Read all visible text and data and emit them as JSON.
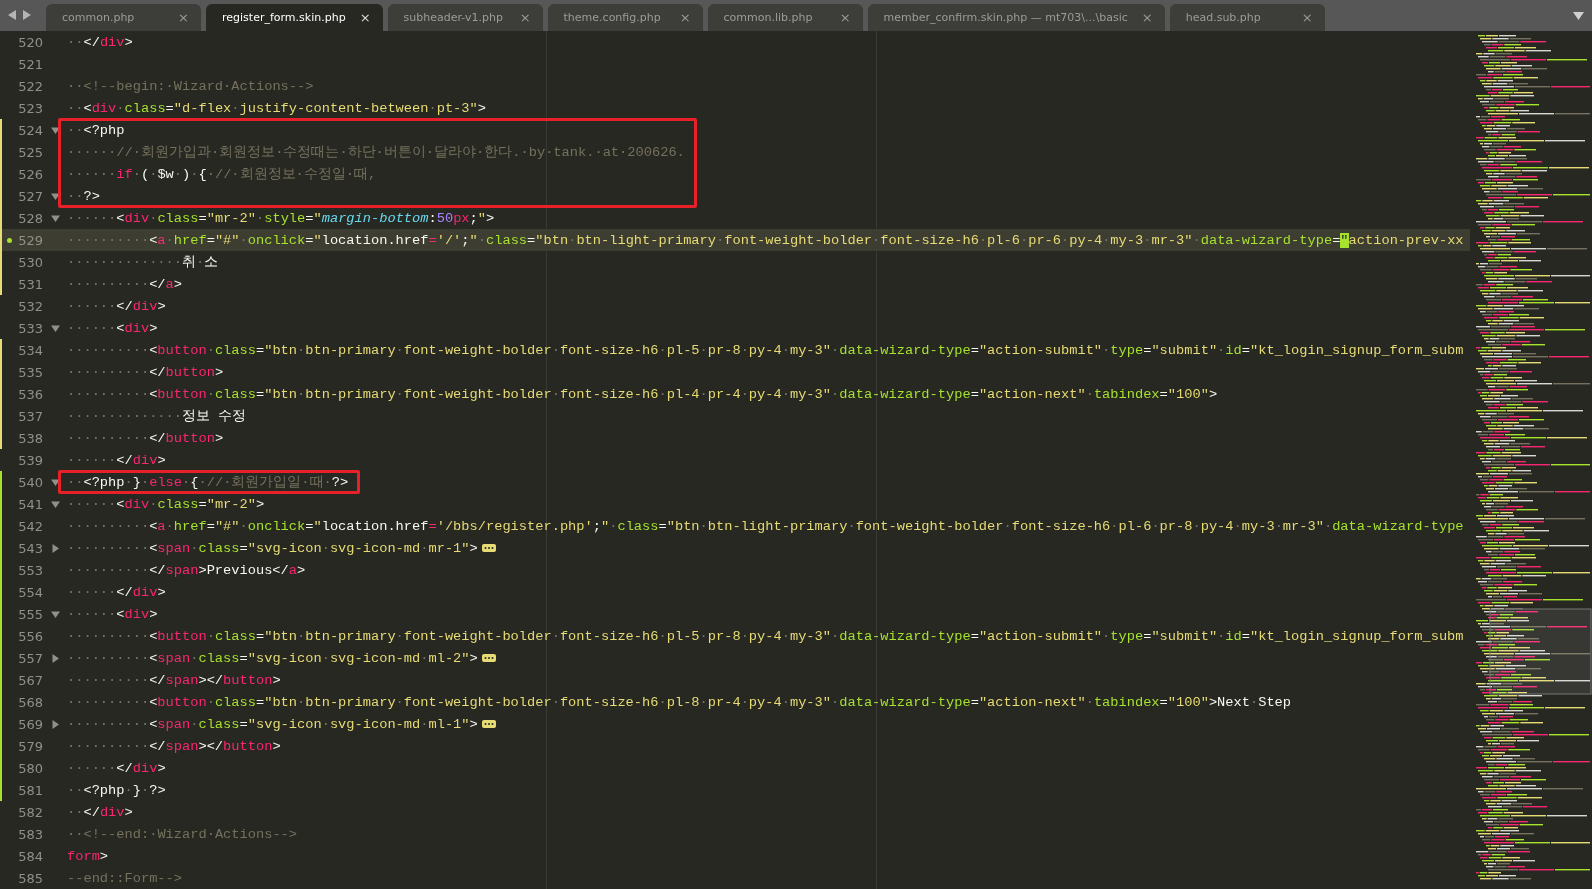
{
  "tabs": [
    {
      "label": "common.php",
      "close": "×",
      "selected": false
    },
    {
      "label": "register_form.skin.php",
      "close": "×",
      "selected": true
    },
    {
      "label": "subheader-v1.php",
      "close": "×",
      "selected": false
    },
    {
      "label": "theme.config.php",
      "close": "×",
      "selected": false
    },
    {
      "label": "common.lib.php",
      "close": "×",
      "selected": false
    },
    {
      "label": "member_confirm.skin.php — mt703\\...\\basic",
      "close": "×",
      "selected": false
    },
    {
      "label": "head.sub.php",
      "close": "×",
      "selected": false
    }
  ],
  "lines": [
    {
      "number": "520",
      "tokens": [
        {
          "kind": "plain",
          "text": "··</"
        },
        {
          "kind": "tag",
          "text": "div"
        },
        {
          "kind": "plain",
          "text": ">"
        }
      ]
    },
    {
      "number": "521"
    },
    {
      "number": "522",
      "tokens": [
        {
          "kind": "comment",
          "text": "··<!--begin:·Wizard·Actions-->"
        }
      ]
    },
    {
      "number": "523",
      "tokens": [
        {
          "kind": "plain",
          "text": "··<"
        },
        {
          "kind": "tag",
          "text": "div"
        },
        {
          "kind": "attr",
          "text": "·class"
        },
        {
          "kind": "plain",
          "text": "="
        },
        {
          "kind": "string",
          "text": "\"d-flex·justify-content-between·pt-3\""
        },
        {
          "kind": "plain",
          "text": ">"
        }
      ]
    },
    {
      "number": "524",
      "expanded": true,
      "color": "#e6db74",
      "boxed": true,
      "tokens": [
        {
          "kind": "plain",
          "text": "··<?php"
        }
      ]
    },
    {
      "number": "525",
      "color": "#e6db74",
      "boxed": true,
      "tokens": [
        {
          "kind": "comment",
          "text": "······//·회원가입과·회원정보·수정때는·하단·버튼이·달라야·한다.·by·tank.·at·200626."
        }
      ]
    },
    {
      "number": "526",
      "color": "#e6db74",
      "boxed": true,
      "tokens": [
        {
          "kind": "plain",
          "text": "······"
        },
        {
          "kind": "keyword",
          "text": "if"
        },
        {
          "kind": "plain",
          "text": "·(·$w·)·{"
        },
        {
          "kind": "comment",
          "text": "·//·회원정보·수정일·때,"
        }
      ]
    },
    {
      "number": "527",
      "expanded": true,
      "color": "#e6db74",
      "boxed": true,
      "tokens": [
        {
          "kind": "plain",
          "text": "··?>"
        }
      ]
    },
    {
      "number": "528",
      "expanded": true,
      "color": "#e6db74",
      "tokens": [
        {
          "kind": "plain",
          "text": "······<"
        },
        {
          "kind": "tag",
          "text": "div"
        },
        {
          "kind": "attr",
          "text": "·class"
        },
        {
          "kind": "plain",
          "text": "="
        },
        {
          "kind": "string",
          "text": "\"mr-2\""
        },
        {
          "kind": "attr",
          "text": "·style"
        },
        {
          "kind": "plain",
          "text": "="
        },
        {
          "kind": "string",
          "text": "\""
        },
        {
          "kind": "italic",
          "text": "margin-bottom"
        },
        {
          "kind": "plain",
          "text": ":"
        },
        {
          "kind": "number",
          "text": "50"
        },
        {
          "kind": "tag",
          "text": "px"
        },
        {
          "kind": "plain",
          "text": ";"
        },
        {
          "kind": "string",
          "text": "\""
        },
        {
          "kind": "plain",
          "text": ">"
        }
      ]
    },
    {
      "number": "529",
      "color": "#e6db74",
      "dot": true,
      "current": true,
      "tokens": [
        {
          "kind": "plain",
          "text": "··········<"
        },
        {
          "kind": "tag",
          "text": "a"
        },
        {
          "kind": "attr",
          "text": "·href"
        },
        {
          "kind": "plain",
          "text": "="
        },
        {
          "kind": "string",
          "text": "\"#\""
        },
        {
          "kind": "attr",
          "text": "·onclick"
        },
        {
          "kind": "plain",
          "text": "="
        },
        {
          "kind": "string",
          "text": "\""
        },
        {
          "kind": "plain",
          "text": "location.href"
        },
        {
          "kind": "tag",
          "text": "="
        },
        {
          "kind": "string",
          "text": "'/'"
        },
        {
          "kind": "plain",
          "text": ";"
        },
        {
          "kind": "string",
          "text": "\""
        },
        {
          "kind": "attr",
          "text": "·class"
        },
        {
          "kind": "plain",
          "text": "="
        },
        {
          "kind": "string",
          "text": "\"btn·btn-light-primary·font-weight-bolder·font-size-h6·pl-6·pr-6·py-4·my-3·mr-3\""
        },
        {
          "kind": "attr",
          "text": "·data-wizard-type"
        },
        {
          "kind": "plain",
          "text": "="
        },
        {
          "kind": "match",
          "text": "\""
        },
        {
          "kind": "string",
          "text": "action-prev-xx"
        }
      ]
    },
    {
      "number": "530",
      "color": "#e6db74",
      "tokens": [
        {
          "kind": "plain",
          "text": "··············취·소"
        }
      ]
    },
    {
      "number": "531",
      "color": "#e6db74",
      "tokens": [
        {
          "kind": "plain",
          "text": "··········</"
        },
        {
          "kind": "tag",
          "text": "a"
        },
        {
          "kind": "plain",
          "text": ">"
        }
      ]
    },
    {
      "number": "532",
      "tokens": [
        {
          "kind": "plain",
          "text": "······</"
        },
        {
          "kind": "tag",
          "text": "div"
        },
        {
          "kind": "plain",
          "text": ">"
        }
      ]
    },
    {
      "number": "533",
      "expanded": true,
      "tokens": [
        {
          "kind": "plain",
          "text": "······<"
        },
        {
          "kind": "tag",
          "text": "div"
        },
        {
          "kind": "plain",
          "text": ">"
        }
      ]
    },
    {
      "number": "534",
      "color": "#e6db74",
      "tokens": [
        {
          "kind": "plain",
          "text": "··········<"
        },
        {
          "kind": "tag",
          "text": "button"
        },
        {
          "kind": "attr",
          "text": "·class"
        },
        {
          "kind": "plain",
          "text": "="
        },
        {
          "kind": "string",
          "text": "\"btn·btn-primary·font-weight-bolder·font-size-h6·pl-5·pr-8·py-4·my-3\""
        },
        {
          "kind": "attr",
          "text": "·data-wizard-type"
        },
        {
          "kind": "plain",
          "text": "="
        },
        {
          "kind": "string",
          "text": "\"action-submit\""
        },
        {
          "kind": "attr",
          "text": "·type"
        },
        {
          "kind": "plain",
          "text": "="
        },
        {
          "kind": "string",
          "text": "\"submit\""
        },
        {
          "kind": "attr",
          "text": "·id"
        },
        {
          "kind": "plain",
          "text": "="
        },
        {
          "kind": "string",
          "text": "\"kt_login_signup_form_subm"
        }
      ]
    },
    {
      "number": "535",
      "color": "#e6db74",
      "tokens": [
        {
          "kind": "plain",
          "text": "··········</"
        },
        {
          "kind": "tag",
          "text": "button"
        },
        {
          "kind": "plain",
          "text": ">"
        }
      ]
    },
    {
      "number": "536",
      "color": "#e6db74",
      "tokens": [
        {
          "kind": "plain",
          "text": "··········<"
        },
        {
          "kind": "tag",
          "text": "button"
        },
        {
          "kind": "attr",
          "text": "·class"
        },
        {
          "kind": "plain",
          "text": "="
        },
        {
          "kind": "string",
          "text": "\"btn·btn-primary·font-weight-bolder·font-size-h6·pl-4·pr-4·py-4·my-3\""
        },
        {
          "kind": "attr",
          "text": "·data-wizard-type"
        },
        {
          "kind": "plain",
          "text": "="
        },
        {
          "kind": "string",
          "text": "\"action-next\""
        },
        {
          "kind": "attr",
          "text": "·tabindex"
        },
        {
          "kind": "plain",
          "text": "="
        },
        {
          "kind": "string",
          "text": "\"100\""
        },
        {
          "kind": "plain",
          "text": ">"
        }
      ]
    },
    {
      "number": "537",
      "color": "#e6db74",
      "tokens": [
        {
          "kind": "plain",
          "text": "··············정보 수정"
        }
      ]
    },
    {
      "number": "538",
      "color": "#e6db74",
      "tokens": [
        {
          "kind": "plain",
          "text": "··········</"
        },
        {
          "kind": "tag",
          "text": "button"
        },
        {
          "kind": "plain",
          "text": ">"
        }
      ]
    },
    {
      "number": "539",
      "tokens": [
        {
          "kind": "plain",
          "text": "······</"
        },
        {
          "kind": "tag",
          "text": "div"
        },
        {
          "kind": "plain",
          "text": ">"
        }
      ]
    },
    {
      "number": "540",
      "expanded": true,
      "color": "#a6e22e",
      "boxed": true,
      "tokens": [
        {
          "kind": "plain",
          "text": "··<?php·}"
        },
        {
          "kind": "keyword",
          "text": "·else"
        },
        {
          "kind": "plain",
          "text": "·{·"
        },
        {
          "kind": "comment",
          "text": "//·회원가입일·때"
        },
        {
          "kind": "plain",
          "text": "·?>"
        }
      ]
    },
    {
      "number": "541",
      "expanded": true,
      "color": "#a6e22e",
      "tokens": [
        {
          "kind": "plain",
          "text": "······<"
        },
        {
          "kind": "tag",
          "text": "div"
        },
        {
          "kind": "attr",
          "text": "·class"
        },
        {
          "kind": "plain",
          "text": "="
        },
        {
          "kind": "string",
          "text": "\"mr-2\""
        },
        {
          "kind": "plain",
          "text": ">"
        }
      ]
    },
    {
      "number": "542",
      "color": "#a6e22e",
      "tokens": [
        {
          "kind": "plain",
          "text": "··········<"
        },
        {
          "kind": "tag",
          "text": "a"
        },
        {
          "kind": "attr",
          "text": "·href"
        },
        {
          "kind": "plain",
          "text": "="
        },
        {
          "kind": "string",
          "text": "\"#\""
        },
        {
          "kind": "attr",
          "text": "·onclick"
        },
        {
          "kind": "plain",
          "text": "="
        },
        {
          "kind": "string",
          "text": "\""
        },
        {
          "kind": "plain",
          "text": "location.href"
        },
        {
          "kind": "tag",
          "text": "="
        },
        {
          "kind": "string",
          "text": "'/bbs/register.php'"
        },
        {
          "kind": "plain",
          "text": ";"
        },
        {
          "kind": "string",
          "text": "\""
        },
        {
          "kind": "attr",
          "text": "·class"
        },
        {
          "kind": "plain",
          "text": "="
        },
        {
          "kind": "string",
          "text": "\"btn·btn-light-primary·font-weight-bolder·font-size-h6·pl-6·pr-8·py-4·my-3·mr-3\""
        },
        {
          "kind": "attr",
          "text": "·data-wizard-type"
        }
      ]
    },
    {
      "number": "543",
      "expanded": false,
      "color": "#a6e22e",
      "tokens": [
        {
          "kind": "plain",
          "text": "··········<"
        },
        {
          "kind": "tag",
          "text": "span"
        },
        {
          "kind": "attr",
          "text": "·class"
        },
        {
          "kind": "plain",
          "text": "="
        },
        {
          "kind": "string",
          "text": "\"svg-icon·svg-icon-md·mr-1\""
        },
        {
          "kind": "plain",
          "text": ">"
        }
      ]
    },
    {
      "number": "553",
      "color": "#a6e22e",
      "tokens": [
        {
          "kind": "plain",
          "text": "··········</"
        },
        {
          "kind": "tag",
          "text": "span"
        },
        {
          "kind": "plain",
          "text": ">Previous</"
        },
        {
          "kind": "tag",
          "text": "a"
        },
        {
          "kind": "plain",
          "text": ">"
        }
      ]
    },
    {
      "number": "554",
      "color": "#a6e22e",
      "tokens": [
        {
          "kind": "plain",
          "text": "······</"
        },
        {
          "kind": "tag",
          "text": "div"
        },
        {
          "kind": "plain",
          "text": ">"
        }
      ]
    },
    {
      "number": "555",
      "expanded": true,
      "color": "#a6e22e",
      "tokens": [
        {
          "kind": "plain",
          "text": "······<"
        },
        {
          "kind": "tag",
          "text": "div"
        },
        {
          "kind": "plain",
          "text": ">"
        }
      ]
    },
    {
      "number": "556",
      "color": "#a6e22e",
      "tokens": [
        {
          "kind": "plain",
          "text": "··········<"
        },
        {
          "kind": "tag",
          "text": "button"
        },
        {
          "kind": "attr",
          "text": "·class"
        },
        {
          "kind": "plain",
          "text": "="
        },
        {
          "kind": "string",
          "text": "\"btn·btn-primary·font-weight-bolder·font-size-h6·pl-5·pr-8·py-4·my-3\""
        },
        {
          "kind": "attr",
          "text": "·data-wizard-type"
        },
        {
          "kind": "plain",
          "text": "="
        },
        {
          "kind": "string",
          "text": "\"action-submit\""
        },
        {
          "kind": "attr",
          "text": "·type"
        },
        {
          "kind": "plain",
          "text": "="
        },
        {
          "kind": "string",
          "text": "\"submit\""
        },
        {
          "kind": "attr",
          "text": "·id"
        },
        {
          "kind": "plain",
          "text": "="
        },
        {
          "kind": "string",
          "text": "\"kt_login_signup_form_subm"
        }
      ]
    },
    {
      "number": "557",
      "expanded": false,
      "color": "#a6e22e",
      "tokens": [
        {
          "kind": "plain",
          "text": "··········<"
        },
        {
          "kind": "tag",
          "text": "span"
        },
        {
          "kind": "attr",
          "text": "·class"
        },
        {
          "kind": "plain",
          "text": "="
        },
        {
          "kind": "string",
          "text": "\"svg-icon·svg-icon-md·ml-2\""
        },
        {
          "kind": "plain",
          "text": ">"
        }
      ]
    },
    {
      "number": "567",
      "color": "#a6e22e",
      "tokens": [
        {
          "kind": "plain",
          "text": "··········</"
        },
        {
          "kind": "tag",
          "text": "span"
        },
        {
          "kind": "plain",
          "text": "></"
        },
        {
          "kind": "tag",
          "text": "button"
        },
        {
          "kind": "plain",
          "text": ">"
        }
      ]
    },
    {
      "number": "568",
      "color": "#a6e22e",
      "tokens": [
        {
          "kind": "plain",
          "text": "··········<"
        },
        {
          "kind": "tag",
          "text": "button"
        },
        {
          "kind": "attr",
          "text": "·class"
        },
        {
          "kind": "plain",
          "text": "="
        },
        {
          "kind": "string",
          "text": "\"btn·btn-primary·font-weight-bolder·font-size-h6·pl-8·pr-4·py-4·my-3\""
        },
        {
          "kind": "attr",
          "text": "·data-wizard-type"
        },
        {
          "kind": "plain",
          "text": "="
        },
        {
          "kind": "string",
          "text": "\"action-next\""
        },
        {
          "kind": "attr",
          "text": "·tabindex"
        },
        {
          "kind": "plain",
          "text": "="
        },
        {
          "kind": "string",
          "text": "\"100\""
        },
        {
          "kind": "plain",
          "text": ">Next·Step"
        }
      ]
    },
    {
      "number": "569",
      "expanded": false,
      "color": "#a6e22e",
      "tokens": [
        {
          "kind": "plain",
          "text": "··········<"
        },
        {
          "kind": "tag",
          "text": "span"
        },
        {
          "kind": "attr",
          "text": "·class"
        },
        {
          "kind": "plain",
          "text": "="
        },
        {
          "kind": "string",
          "text": "\"svg-icon·svg-icon-md·ml-1\""
        },
        {
          "kind": "plain",
          "text": ">"
        }
      ]
    },
    {
      "number": "579",
      "color": "#a6e22e",
      "tokens": [
        {
          "kind": "plain",
          "text": "··········</"
        },
        {
          "kind": "tag",
          "text": "span"
        },
        {
          "kind": "plain",
          "text": "></"
        },
        {
          "kind": "tag",
          "text": "button"
        },
        {
          "kind": "plain",
          "text": ">"
        }
      ]
    },
    {
      "number": "580",
      "color": "#a6e22e",
      "tokens": [
        {
          "kind": "plain",
          "text": "······</"
        },
        {
          "kind": "tag",
          "text": "div"
        },
        {
          "kind": "plain",
          "text": ">"
        }
      ]
    },
    {
      "number": "581",
      "color": "#a6e22e",
      "tokens": [
        {
          "kind": "plain",
          "text": "··<?php·}·?>"
        }
      ]
    },
    {
      "number": "582",
      "tokens": [
        {
          "kind": "plain",
          "text": "··</"
        },
        {
          "kind": "tag",
          "text": "div"
        },
        {
          "kind": "plain",
          "text": ">"
        }
      ]
    },
    {
      "number": "583",
      "tokens": [
        {
          "kind": "comment",
          "text": "··<!--end:·Wizard·Actions-->"
        }
      ]
    },
    {
      "number": "584",
      "tokens": [
        {
          "kind": "tag",
          "text": "form"
        },
        {
          "kind": "plain",
          "text": ">"
        }
      ]
    },
    {
      "number": "585",
      "tokens": [
        {
          "kind": "comment",
          "text": "--end::Form-->"
        }
      ]
    }
  ]
}
